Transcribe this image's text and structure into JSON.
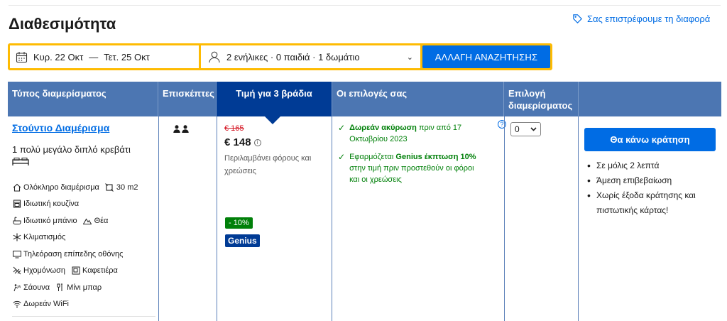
{
  "page": {
    "title": "Διαθεσιμότητα",
    "price_match": "Σας επιστρέφουμε τη διαφορά"
  },
  "search": {
    "checkin": "Κυρ. 22 Οκτ",
    "dash": "—",
    "checkout": "Τετ. 25 Οκτ",
    "guests": "2 ενήλικες · 0 παιδιά · 1 δωμάτιο",
    "button": "ΑΛΛΑΓΗ ΑΝΑΖΗΤΗΣΗΣ"
  },
  "table": {
    "headers": {
      "type": "Τύπος διαμερίσματος",
      "guests": "Επισκέπτες",
      "price": "Τιμή για 3 βράδια",
      "options": "Οι επιλογές σας",
      "select": "Επιλογή διαμερίσματος"
    },
    "room": {
      "name": "Στούντιο Διαμέρισμα",
      "bed": "1 πολύ μεγάλο διπλό κρεβάτι",
      "facilities": [
        [
          "Ολόκληρο διαμέρισμα",
          "30 m2"
        ],
        [
          "Ιδιωτική κουζίνα"
        ],
        [
          "Ιδιωτικό μπάνιο",
          "Θέα"
        ],
        [
          "Κλιματισμός"
        ],
        [
          "Τηλεόραση επίπεδης οθόνης"
        ],
        [
          "Ηχομόνωση",
          "Καφετιέρα"
        ],
        [
          "Σάουνα",
          "Μίνι μπαρ"
        ],
        [
          "Δωρεάν WiFi"
        ]
      ],
      "max_guests": 2,
      "old_price": "€ 165",
      "new_price": "€ 148",
      "tax_note": "Περιλαμβάνει φόρους και χρεώσεις",
      "discount": "- 10%",
      "genius": "Genius",
      "options": {
        "cancel_bold": "Δωρεάν ακύρωση",
        "cancel_rest": "πριν από 17 Οκτωβρίου 2023",
        "genius_pre": "Εφαρμόζεται",
        "genius_bold": "Genius έκπτωση 10%",
        "genius_rest": "στην τιμή πριν προστεθούν οι φόροι και οι χρεώσεις"
      },
      "selected_qty": "0",
      "book_button": "Θα κάνω κράτηση",
      "book_points": [
        "Σε μόλις 2 λεπτά",
        "Άμεση επιβεβαίωση",
        "Χωρίς έξοδα κράτησης και πιστωτικής κάρτας!"
      ]
    }
  },
  "icons": {
    "facilities": [
      [
        "home-icon",
        "size-icon"
      ],
      [
        "kitchen-icon"
      ],
      [
        "bath-icon",
        "view-icon"
      ],
      [
        "ac-icon"
      ],
      [
        "tv-icon"
      ],
      [
        "soundproof-icon",
        "coffee-icon"
      ],
      [
        "sauna-icon",
        "minibar-icon"
      ],
      [
        "wifi-icon"
      ]
    ]
  },
  "colors": {
    "brand_blue": "#006ce4",
    "header_blue": "#4c76b2",
    "dark_blue": "#003b95",
    "accent_yellow": "#febb02",
    "green": "#008009",
    "red": "#d4111e"
  }
}
